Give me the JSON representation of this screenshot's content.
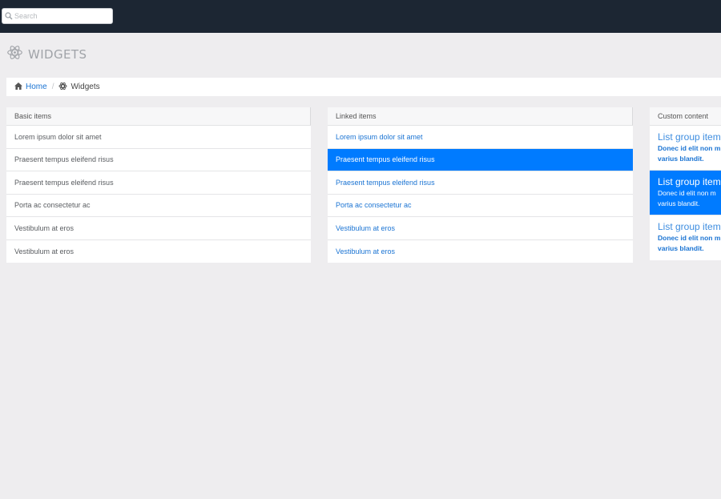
{
  "search": {
    "placeholder": "Search",
    "icon": "search-icon"
  },
  "header": {
    "title": "WIDGETS",
    "icon": "atom-icon"
  },
  "breadcrumb": {
    "home_label": "Home",
    "separator": "/",
    "current_label": "Widgets"
  },
  "basic": {
    "title": "Basic items",
    "items": [
      "Lorem ipsum dolor sit amet",
      "Praesent tempus eleifend risus",
      "Praesent tempus eleifend risus",
      "Porta ac consectetur ac",
      "Vestibulum at eros",
      "Vestibulum at eros"
    ]
  },
  "linked": {
    "title": "Linked items",
    "items": [
      "Lorem ipsum dolor sit amet",
      "Praesent tempus eleifend risus",
      "Praesent tempus eleifend risus",
      "Porta ac consectetur ac",
      "Vestibulum at eros",
      "Vestibulum at eros"
    ]
  },
  "custom": {
    "title": "Custom content",
    "items": [
      {
        "heading": "List group item",
        "text1": "Donec id elit non m",
        "text2": "varius blandit."
      },
      {
        "heading": "List group item",
        "text1": "Donec id elit non m",
        "text2": "varius blandit."
      },
      {
        "heading": "List group item",
        "text1": "Donec id elit non m",
        "text2": "varius blandit."
      }
    ]
  },
  "colors": {
    "topbar": "#1c2633",
    "background": "#eeedef",
    "accent": "#007bff",
    "link": "#1b74d3"
  }
}
